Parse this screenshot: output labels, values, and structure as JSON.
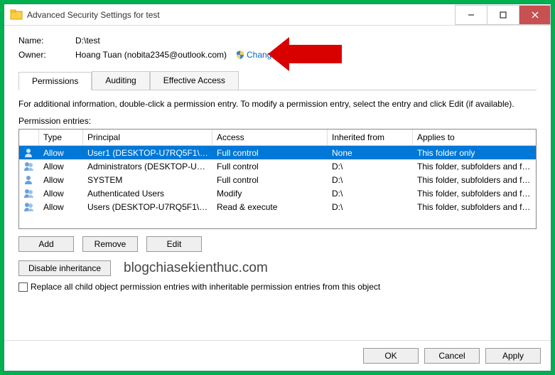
{
  "window": {
    "title": "Advanced Security Settings for test"
  },
  "fields": {
    "name_label": "Name:",
    "name_value": "D:\\test",
    "owner_label": "Owner:",
    "owner_value": "Hoang Tuan (nobita2345@outlook.com)",
    "change_link": "Change"
  },
  "tabs": [
    {
      "label": "Permissions",
      "active": true
    },
    {
      "label": "Auditing",
      "active": false
    },
    {
      "label": "Effective Access",
      "active": false
    }
  ],
  "info_text": "For additional information, double-click a permission entry. To modify a permission entry, select the entry and click Edit (if available).",
  "entries_label": "Permission entries:",
  "columns": {
    "type": "Type",
    "principal": "Principal",
    "access": "Access",
    "inherited": "Inherited from",
    "applies": "Applies to"
  },
  "rows": [
    {
      "icon": "user",
      "type": "Allow",
      "principal": "User1 (DESKTOP-U7RQ5F1\\Us...",
      "access": "Full control",
      "inherited": "None",
      "applies": "This folder only",
      "selected": true
    },
    {
      "icon": "users",
      "type": "Allow",
      "principal": "Administrators (DESKTOP-U7...",
      "access": "Full control",
      "inherited": "D:\\",
      "applies": "This folder, subfolders and files",
      "selected": false
    },
    {
      "icon": "user",
      "type": "Allow",
      "principal": "SYSTEM",
      "access": "Full control",
      "inherited": "D:\\",
      "applies": "This folder, subfolders and files",
      "selected": false
    },
    {
      "icon": "users",
      "type": "Allow",
      "principal": "Authenticated Users",
      "access": "Modify",
      "inherited": "D:\\",
      "applies": "This folder, subfolders and files",
      "selected": false
    },
    {
      "icon": "users",
      "type": "Allow",
      "principal": "Users (DESKTOP-U7RQ5F1\\Us...",
      "access": "Read & execute",
      "inherited": "D:\\",
      "applies": "This folder, subfolders and files",
      "selected": false
    }
  ],
  "buttons": {
    "add": "Add",
    "remove": "Remove",
    "edit": "Edit",
    "disable": "Disable inheritance",
    "ok": "OK",
    "cancel": "Cancel",
    "apply": "Apply"
  },
  "replace_label": "Replace all child object permission entries with inheritable permission entries from this object",
  "watermark": "blogchiasekienthuc.com"
}
